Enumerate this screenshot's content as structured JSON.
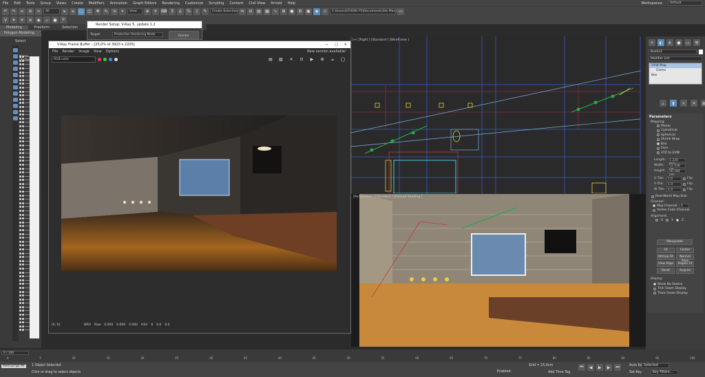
{
  "menubar": {
    "items": [
      "File",
      "Edit",
      "Tools",
      "Group",
      "Views",
      "Create",
      "Modifiers",
      "Animation",
      "Graph Editors",
      "Rendering",
      "Customize",
      "Scripting",
      "Content",
      "Civil View",
      "Arnold",
      "Help"
    ],
    "workspace_label": "Workspaces:",
    "workspace_value": "Default"
  },
  "toolbar": {
    "filter_value": "All",
    "view_value": "View",
    "selection_set": "Create Selection Se",
    "project_path": "C:\\Users\\STUDIO P1\\Documents\\3ds Max 2022"
  },
  "ribbon": {
    "tabs": [
      "Modeling",
      "Freeform",
      "Selection"
    ],
    "active_tab": "Modeling",
    "polygon_modeling": "Polygon Modeling"
  },
  "scene_explorer": {
    "select_label": "Select",
    "name_header": "Name (Sorted..."
  },
  "render_setup": {
    "title": "Render Setup: V-Ray 5, update 1.2",
    "target_label": "Target:",
    "target_value": "Production Rendering Mode",
    "render_button": "Render"
  },
  "frame_buffer": {
    "title": "V-Ray Frame Buffer - [25,0% of 3920 x 2205]",
    "menu": [
      "File",
      "Render",
      "Image",
      "View",
      "Options"
    ],
    "new_version": "New version available!",
    "channel": "RGB color",
    "coords": "[0, 0]",
    "status_items": [
      "BRO",
      "Raw",
      "0.000",
      "0.000",
      "0.000",
      "HSV",
      "0",
      "0.0",
      "0.0"
    ]
  },
  "viewport_top_label": "[+] [Right ] [Standard ] [Wireframe ]",
  "viewport_bottom_label": "[Perspective ] [Standard ] [Default Shading ]",
  "command_panel": {
    "object_name": "Box022",
    "modifier_list": "Modifier List",
    "stack": [
      "UVW Map",
      "Gizmo",
      "Box"
    ],
    "parameters_title": "Parameters",
    "mapping_label": "Mapping:",
    "mapping_options": [
      "Planar",
      "Cylindrical",
      "Spherical",
      "Shrink Wrap",
      "Box",
      "Face",
      "XYZ to UVW"
    ],
    "mapping_selected": "Box",
    "length_label": "Length:",
    "length_value": "1.220 mm",
    "width_label": "Width:",
    "width_value": "52.438 cm",
    "height_label": "Height:",
    "height_value": "56.584 cm",
    "utile_label": "U Tile:",
    "utile_value": "1.0",
    "vtile_label": "V Tile:",
    "vtile_value": "1.0",
    "wtile_label": "W Tile:",
    "wtile_value": "1.0",
    "flip_label": "Flip",
    "real_world": "Real-World Map Size",
    "channel_label": "Channel:",
    "map_channel": "Map Channel:",
    "map_channel_value": "1",
    "vertex_color": "Vertex Color Channel",
    "alignment_label": "Alignment:",
    "axes": [
      "X",
      "Y",
      "Z"
    ],
    "manipulate": "Manipulate",
    "align_buttons": [
      "Fit",
      "Center",
      "Bitmap Fit",
      "Normal Align",
      "View Align",
      "Region Fit",
      "Reset",
      "Acquire"
    ],
    "display_label": "Display:",
    "display_options": [
      "Show No Seams",
      "Thin Seam Display",
      "Thick Seam Display"
    ]
  },
  "timeline": {
    "frame_value": "0 / 100",
    "ticks": [
      "0",
      "5",
      "10",
      "15",
      "20",
      "25",
      "30",
      "35",
      "40",
      "45",
      "50",
      "55",
      "60",
      "65",
      "70",
      "75",
      "80",
      "85",
      "90",
      "95",
      "100"
    ]
  },
  "statusbar": {
    "maxscript": "MAXScript Mi",
    "selected": "1 Object Selected",
    "prompt": "Click or drag to select objects",
    "enabled_label": "Enabled:",
    "grid": "Grid = 25,4cm",
    "add_time_tag": "Add Time Tag",
    "auto_key": "Auto Key",
    "set_key": "Set Key",
    "selected_dropdown": "Selected",
    "key_filters": "Key Filters..."
  }
}
